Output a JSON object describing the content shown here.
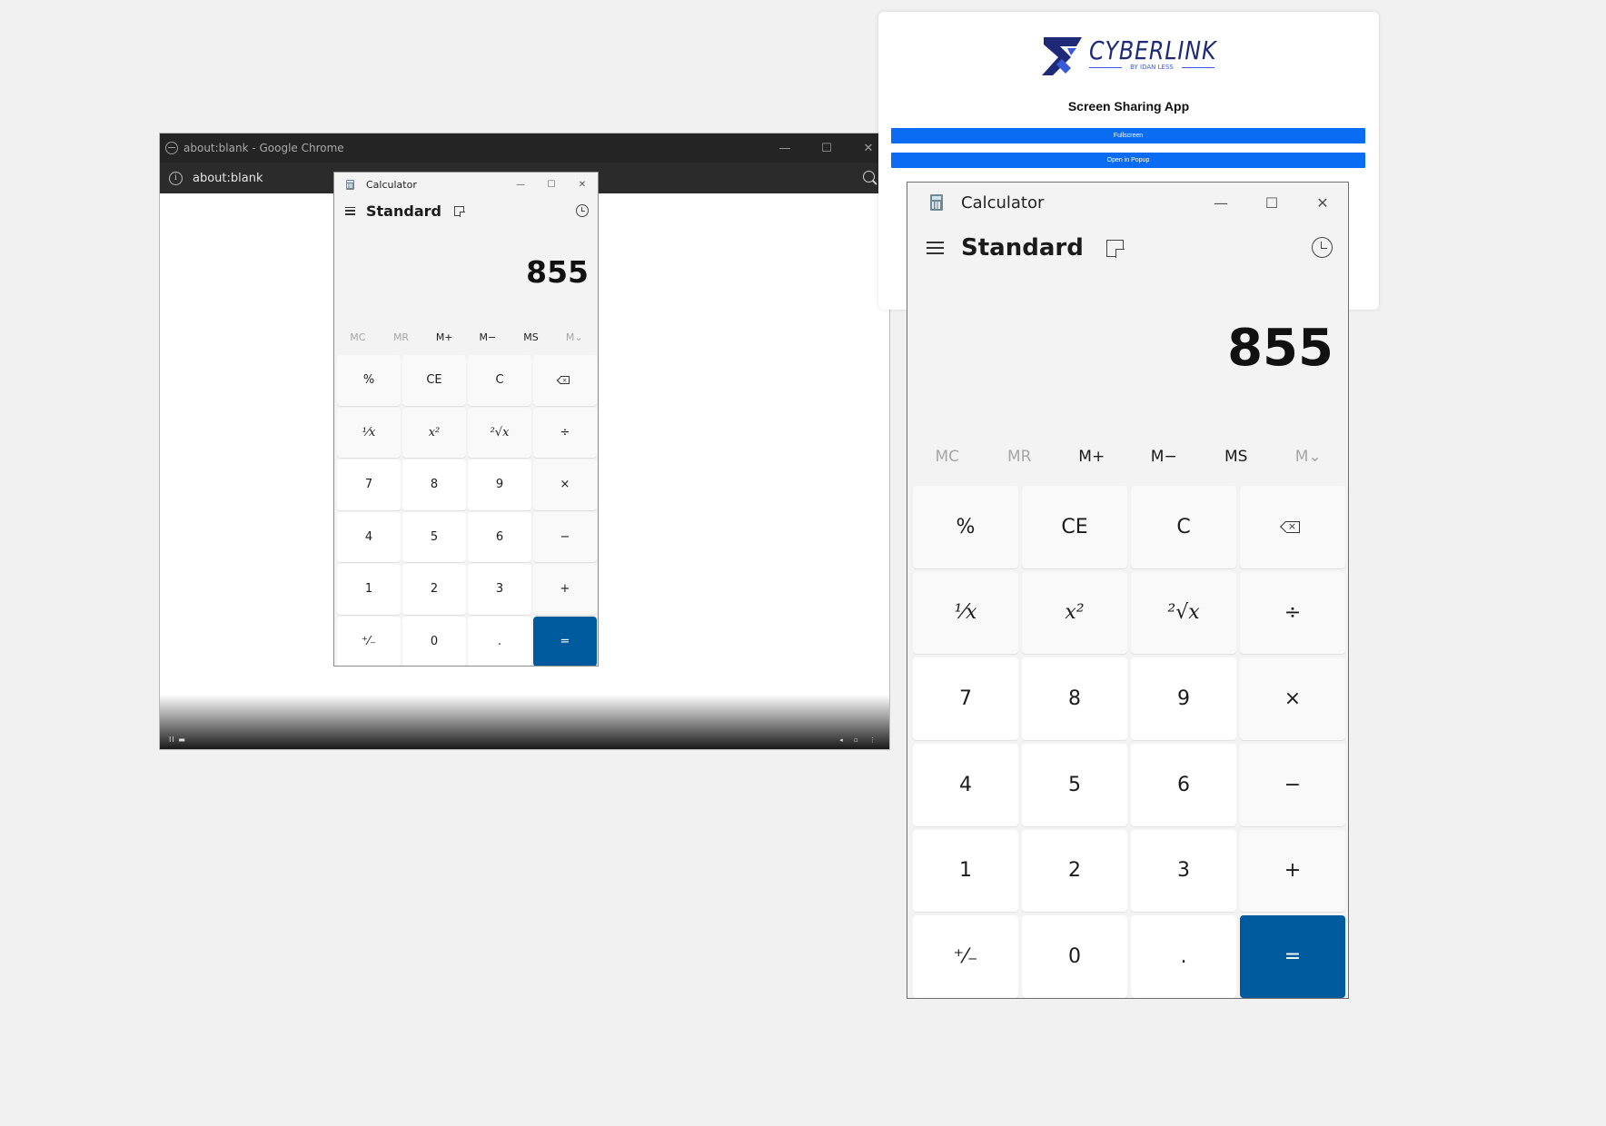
{
  "chrome": {
    "title": "about:blank - Google Chrome",
    "url": "about:blank",
    "controls": {
      "minimize": "—",
      "maximize": "☐",
      "close": "✕"
    },
    "video_controls_left": "II ▬",
    "video_controls_right": "◂ ▫ ⋮"
  },
  "calc_small": {
    "title": "Calculator",
    "mode": "Standard",
    "display": "855",
    "controls": {
      "minimize": "—",
      "maximize": "☐",
      "close": "✕"
    },
    "memory": [
      "MC",
      "MR",
      "M+",
      "M−",
      "MS",
      "M⌄"
    ],
    "keys": [
      "%",
      "CE",
      "C",
      "",
      "¹⁄x",
      "x²",
      "²√x",
      "÷",
      "7",
      "8",
      "9",
      "×",
      "4",
      "5",
      "6",
      "−",
      "1",
      "2",
      "3",
      "+",
      "⁺⁄₋",
      "0",
      ".",
      "="
    ]
  },
  "panel": {
    "logo_text": "CYBERLINK",
    "logo_sub": "BY IDAN LESS",
    "title": "Screen Sharing App",
    "fullscreen_label": "Fullscreen",
    "popup_label": "Open in Popup",
    "accent_color": "#0a6cf2"
  },
  "calc_large": {
    "title": "Calculator",
    "mode": "Standard",
    "display": "855",
    "controls": {
      "minimize": "—",
      "maximize": "☐",
      "close": "✕"
    },
    "memory": [
      "MC",
      "MR",
      "M+",
      "M−",
      "MS",
      "M⌄"
    ],
    "keys": [
      "%",
      "CE",
      "C",
      "",
      "¹⁄x",
      "x²",
      "²√x",
      "÷",
      "7",
      "8",
      "9",
      "×",
      "4",
      "5",
      "6",
      "−",
      "1",
      "2",
      "3",
      "+",
      "⁺⁄₋",
      "0",
      ".",
      "="
    ]
  },
  "colors": {
    "equals": "#005a9e",
    "chrome_titlebar": "#242424"
  },
  "icons": [
    "globe-icon",
    "info-icon",
    "zoom-icon",
    "calculator-app-icon",
    "hamburger-icon",
    "keep-on-top-icon",
    "history-icon",
    "backspace-icon",
    "cyberlink-logo-icon"
  ]
}
